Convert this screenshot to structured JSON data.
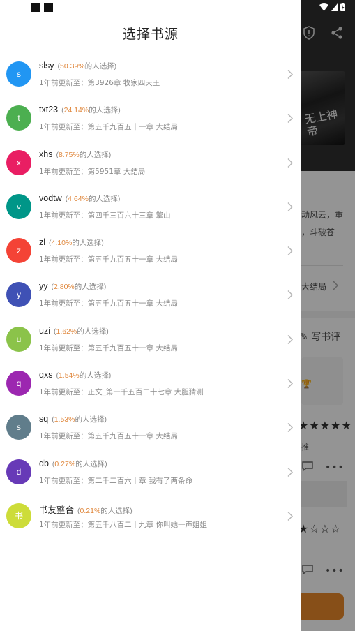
{
  "drawer": {
    "title": "选择书源",
    "pct_suffix": "的人选择)",
    "pct_prefix": "(",
    "sources": [
      {
        "avatar": "s",
        "color": "#2196f3",
        "name": "slsy",
        "percent": "50.39%",
        "update": "1年前更新至：第3926章 牧家四天王"
      },
      {
        "avatar": "t",
        "color": "#4caf50",
        "name": "txt23",
        "percent": "24.14%",
        "update": "1年前更新至：第五千九百五十一章 大结局"
      },
      {
        "avatar": "x",
        "color": "#e91e63",
        "name": "xhs",
        "percent": "8.75%",
        "update": "1年前更新至：第5951章 大结局"
      },
      {
        "avatar": "v",
        "color": "#009688",
        "name": "vodtw",
        "percent": "4.64%",
        "update": "1年前更新至：第四千三百六十三章 擎山"
      },
      {
        "avatar": "z",
        "color": "#f44336",
        "name": "zl",
        "percent": "4.10%",
        "update": "1年前更新至：第五千九百五十一章 大结局"
      },
      {
        "avatar": "y",
        "color": "#3f51b5",
        "name": "yy",
        "percent": "2.80%",
        "update": "1年前更新至：第五千九百五十一章 大结局"
      },
      {
        "avatar": "u",
        "color": "#8bc34a",
        "name": "uzi",
        "percent": "1.62%",
        "update": "1年前更新至：第五千九百五十一章 大结局"
      },
      {
        "avatar": "q",
        "color": "#9c27b0",
        "name": "qxs",
        "percent": "1.54%",
        "update": "1年前更新至：正文_第一千五百二十七章 大胆猜测"
      },
      {
        "avatar": "s",
        "color": "#607d8b",
        "name": "sq",
        "percent": "1.53%",
        "update": "1年前更新至：第五千九百五十一章 大结局"
      },
      {
        "avatar": "d",
        "color": "#673ab7",
        "name": "db",
        "percent": "0.27%",
        "update": "1年前更新至：第二千二百六十章 我有了两条命"
      },
      {
        "avatar": "书",
        "color": "#cddc39",
        "name": "书友整合",
        "percent": "0.21%",
        "update": "1年前更新至：第五千八百二十九章 你叫她一声姐姐"
      }
    ]
  },
  "background": {
    "cover_text": "无上神帝",
    "description": "动风云，重\n，斗破苍",
    "latest_label": "大结局",
    "write_review": "写书评",
    "tag": "推"
  },
  "colors": {
    "accent": "#e0873c",
    "button": "#e8892a"
  }
}
